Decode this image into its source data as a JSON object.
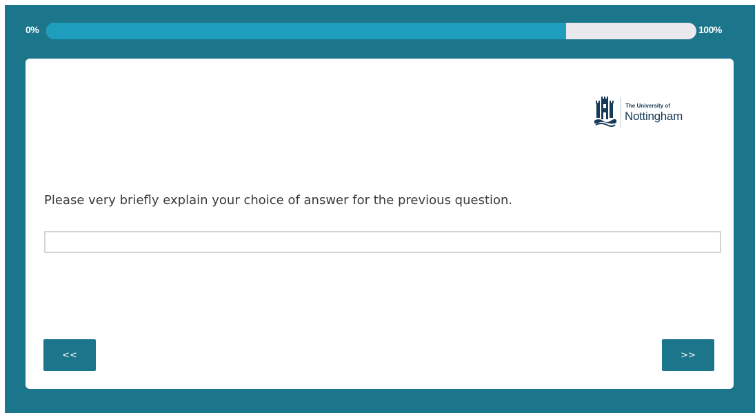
{
  "progress": {
    "min_label": "0%",
    "max_label": "100%",
    "percent_complete": 80,
    "fill_color": "#1f9dbd",
    "track_color": "#e9e8ec"
  },
  "logo": {
    "line_small": "The University of",
    "line_big": "Nottingham",
    "icon": "castle-crest-icon"
  },
  "question": {
    "text": "Please very briefly explain your choice of answer for the previous question."
  },
  "answer_field": {
    "value": "",
    "placeholder": ""
  },
  "navigation": {
    "back_label": "<<",
    "next_label": ">>"
  },
  "colors": {
    "frame": "#1b758b",
    "card": "#ffffff",
    "brand_text": "#163a58"
  }
}
